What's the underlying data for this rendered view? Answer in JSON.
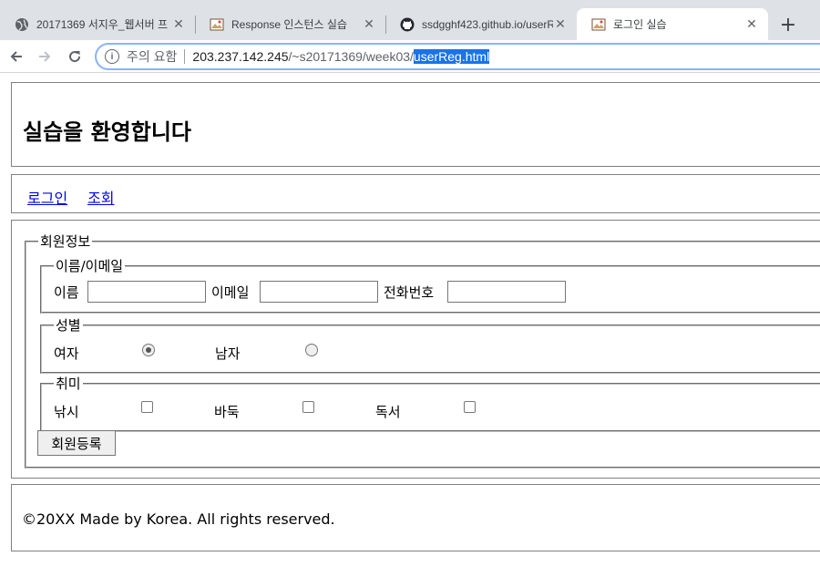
{
  "browser": {
    "tabs": [
      {
        "title": "20171369 서지우_웹서버 프"
      },
      {
        "title": "Response 인스턴스 실습"
      },
      {
        "title": "ssdgghf423.github.io/userR"
      },
      {
        "title": "로그인 실습"
      }
    ],
    "address": {
      "security_label": "주의 요함",
      "host": "203.237.142.245",
      "path": "/~s20171369/week03/",
      "selected": "userReg.html"
    }
  },
  "page": {
    "heading": "실습을 환영합니다",
    "nav": [
      "로그인",
      "조회"
    ],
    "form": {
      "outer_legend": "회원정보",
      "name_email": {
        "legend": "이름/이메일",
        "name_label": "이름",
        "email_label": "이메일",
        "phone_label": "전화번호"
      },
      "gender": {
        "legend": "성별",
        "female": "여자",
        "male": "남자",
        "selected": "여자"
      },
      "hobby": {
        "legend": "취미",
        "fishing": "낚시",
        "baduk": "바둑",
        "reading": "독서"
      },
      "submit": "회원등록"
    },
    "footer": "©20XX Made by Korea. All rights reserved."
  }
}
